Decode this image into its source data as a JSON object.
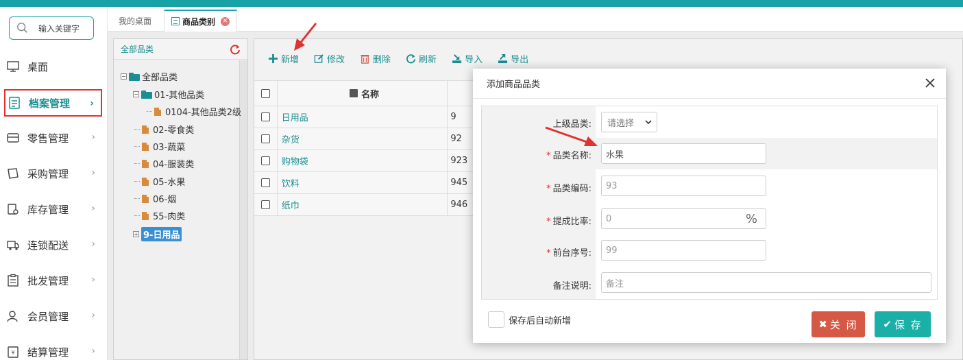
{
  "colors": {
    "accent": "#17a2a6",
    "highlight_border": "#e0322e",
    "close_btn": "#d65946",
    "save_btn": "#1ab0a8"
  },
  "sidebar": {
    "search_placeholder": "输入关键字",
    "items": [
      {
        "label": "桌面",
        "icon": "desktop-icon",
        "has_chevron": false
      },
      {
        "label": "档案管理",
        "icon": "archive-icon",
        "has_chevron": true,
        "active": true
      },
      {
        "label": "零售管理",
        "icon": "store-icon",
        "has_chevron": true
      },
      {
        "label": "采购管理",
        "icon": "purchase-icon",
        "has_chevron": true
      },
      {
        "label": "库存管理",
        "icon": "inventory-icon",
        "has_chevron": true
      },
      {
        "label": "连锁配送",
        "icon": "truck-icon",
        "has_chevron": true
      },
      {
        "label": "批发管理",
        "icon": "wholesale-icon",
        "has_chevron": true
      },
      {
        "label": "会员管理",
        "icon": "member-icon",
        "has_chevron": true
      },
      {
        "label": "结算管理",
        "icon": "settlement-icon",
        "has_chevron": true
      }
    ]
  },
  "tabs": [
    {
      "label": "我的桌面",
      "active": false
    },
    {
      "label": "商品类别",
      "active": true,
      "closable": true
    }
  ],
  "tree": {
    "header": "全部品类",
    "nodes": [
      {
        "label": "全部品类",
        "level": 0,
        "type": "folder",
        "expanded": true
      },
      {
        "label": "01-其他品类",
        "level": 1,
        "type": "folder",
        "expanded": true
      },
      {
        "label": "0104-其他品类2级",
        "level": 2,
        "type": "doc"
      },
      {
        "label": "02-零食类",
        "level": 1,
        "type": "doc"
      },
      {
        "label": "03-蔬菜",
        "level": 1,
        "type": "doc"
      },
      {
        "label": "04-服装类",
        "level": 1,
        "type": "doc"
      },
      {
        "label": "05-水果",
        "level": 1,
        "type": "doc"
      },
      {
        "label": "06-烟",
        "level": 1,
        "type": "doc"
      },
      {
        "label": "55-肉类",
        "level": 1,
        "type": "doc"
      },
      {
        "label": "9-日用品",
        "level": 1,
        "type": "folder",
        "selected": true,
        "collapsed": true
      }
    ]
  },
  "toolbar": {
    "add": "新增",
    "edit": "修改",
    "delete": "删除",
    "refresh": "刷新",
    "import": "导入",
    "export": "导出"
  },
  "table": {
    "col_name": "名称",
    "rows": [
      {
        "name": "日用品",
        "code": "9"
      },
      {
        "name": "杂货",
        "code": "92"
      },
      {
        "name": "购物袋",
        "code": "923"
      },
      {
        "name": "饮料",
        "code": "945"
      },
      {
        "name": "纸巾",
        "code": "946"
      }
    ]
  },
  "modal": {
    "title": "添加商品品类",
    "fields": {
      "parent_label": "上级品类:",
      "parent_value": "请选择",
      "name_label": "品类名称:",
      "name_value": "水果",
      "code_label": "品类编码:",
      "code_value": "93",
      "rate_label": "提成比率:",
      "rate_value": "0",
      "rate_unit": "%",
      "seq_label": "前台序号:",
      "seq_value": "99",
      "remark_label": "备注说明:",
      "remark_placeholder": "备注"
    },
    "auto_add_label": "保存后自动新增",
    "close_label": "关 闭",
    "save_label": "保 存"
  }
}
